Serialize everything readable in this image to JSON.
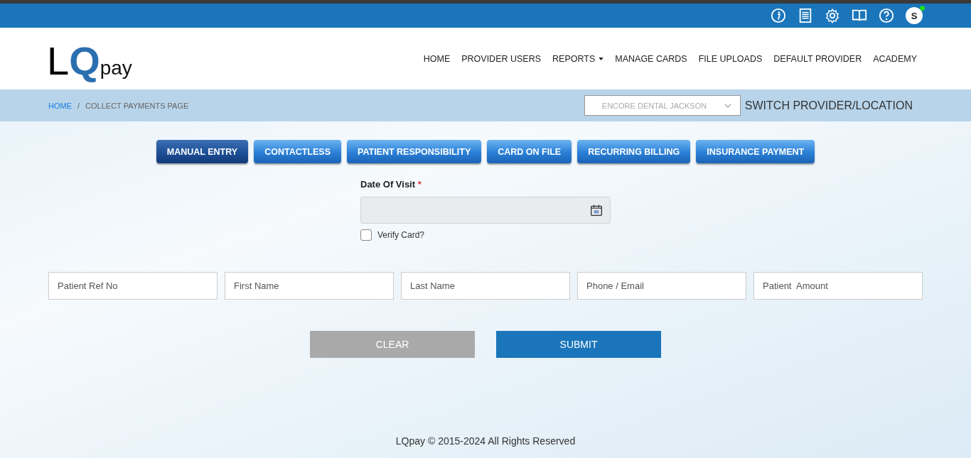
{
  "top_bar": {
    "avatar_letter": "S",
    "online": true
  },
  "logo": {
    "part1": "L",
    "part2": "Q",
    "part3": "pay"
  },
  "nav": [
    {
      "label": "HOME",
      "dropdown": false
    },
    {
      "label": "PROVIDER USERS",
      "dropdown": false
    },
    {
      "label": "REPORTS",
      "dropdown": true
    },
    {
      "label": "MANAGE CARDS",
      "dropdown": false
    },
    {
      "label": "FILE UPLOADS",
      "dropdown": false
    },
    {
      "label": "DEFAULT PROVIDER",
      "dropdown": false
    },
    {
      "label": "ACADEMY",
      "dropdown": false
    }
  ],
  "breadcrumb": [
    {
      "label": "HOME",
      "link": true
    },
    {
      "label": "/",
      "link": false
    },
    {
      "label": "COLLECT PAYMENTS PAGE",
      "link": false
    }
  ],
  "provider_select": {
    "value": "ENCORE DENTAL JACKSON"
  },
  "switch_label": "SWITCH PROVIDER/LOCATION",
  "tabs": [
    {
      "label": "MANUAL ENTRY",
      "selected": true
    },
    {
      "label": "CONTACTLESS",
      "selected": false
    },
    {
      "label": "PATIENT RESPONSIBILITY",
      "selected": false
    },
    {
      "label": "CARD ON FILE",
      "selected": false
    },
    {
      "label": "RECURRING BILLING",
      "selected": false
    },
    {
      "label": "INSURANCE PAYMENT",
      "selected": false
    }
  ],
  "date_field": {
    "label": "Date Of Visit",
    "required_mark": "*"
  },
  "verify_card": {
    "label": "Verify Card?",
    "checked": false
  },
  "fields": [
    {
      "placeholder": "Patient Ref No"
    },
    {
      "placeholder": "First Name"
    },
    {
      "placeholder": "Last Name"
    },
    {
      "placeholder": "Phone / Email"
    },
    {
      "placeholder": "Patient  Amount"
    }
  ],
  "buttons": [
    {
      "label": "CLEAR",
      "kind": "secondary"
    },
    {
      "label": "SUBMIT",
      "kind": "primary"
    }
  ],
  "footer": "LQpay © 2015-2024 All Rights Reserved"
}
